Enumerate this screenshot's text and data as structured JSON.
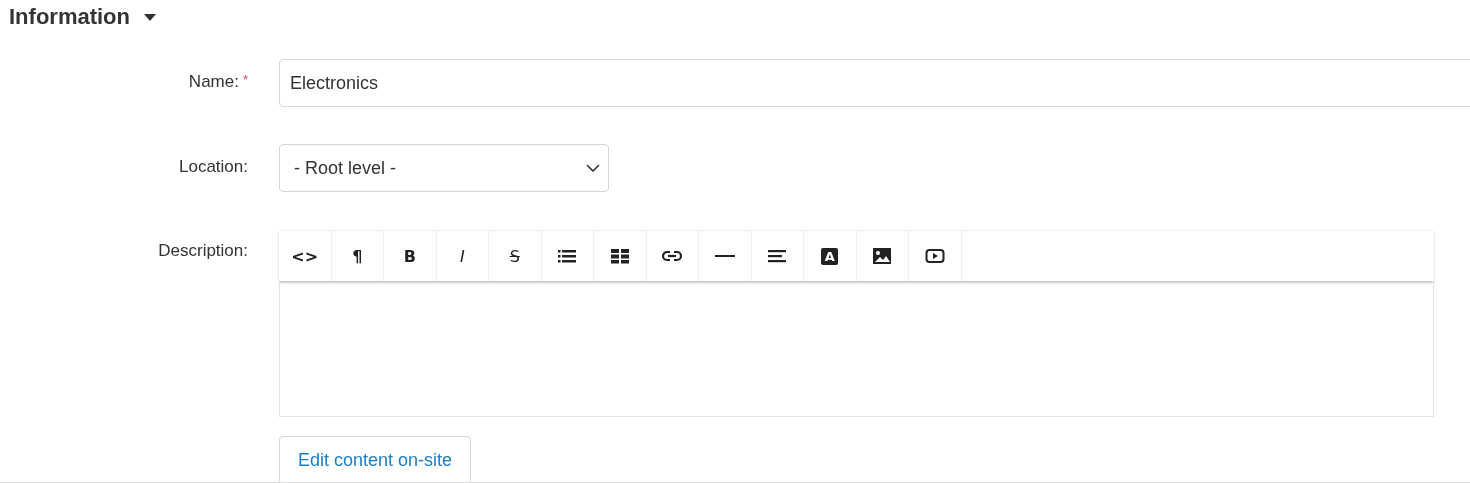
{
  "section": {
    "title": "Information",
    "expanded": true
  },
  "fields": [
    {
      "kind": "text",
      "label": "Name:",
      "required_mark": "*",
      "value": "Electronics"
    },
    {
      "kind": "select",
      "label": "Location:",
      "value": "- Root level -"
    },
    {
      "kind": "editor",
      "label": "Description:",
      "toolbar": [
        {
          "kind": "glyph",
          "glyph": "<>"
        },
        {
          "kind": "glyph",
          "glyph": "¶"
        },
        {
          "kind": "bold",
          "glyph": "B"
        },
        {
          "kind": "italic",
          "glyph": "I"
        },
        {
          "kind": "strike",
          "glyph": "S"
        },
        {
          "kind": "list"
        },
        {
          "kind": "table"
        },
        {
          "kind": "link"
        },
        {
          "kind": "rule"
        },
        {
          "kind": "align"
        },
        {
          "kind": "color",
          "glyph": "A"
        },
        {
          "kind": "image"
        },
        {
          "kind": "video"
        }
      ]
    }
  ],
  "button": "Edit content on-site"
}
